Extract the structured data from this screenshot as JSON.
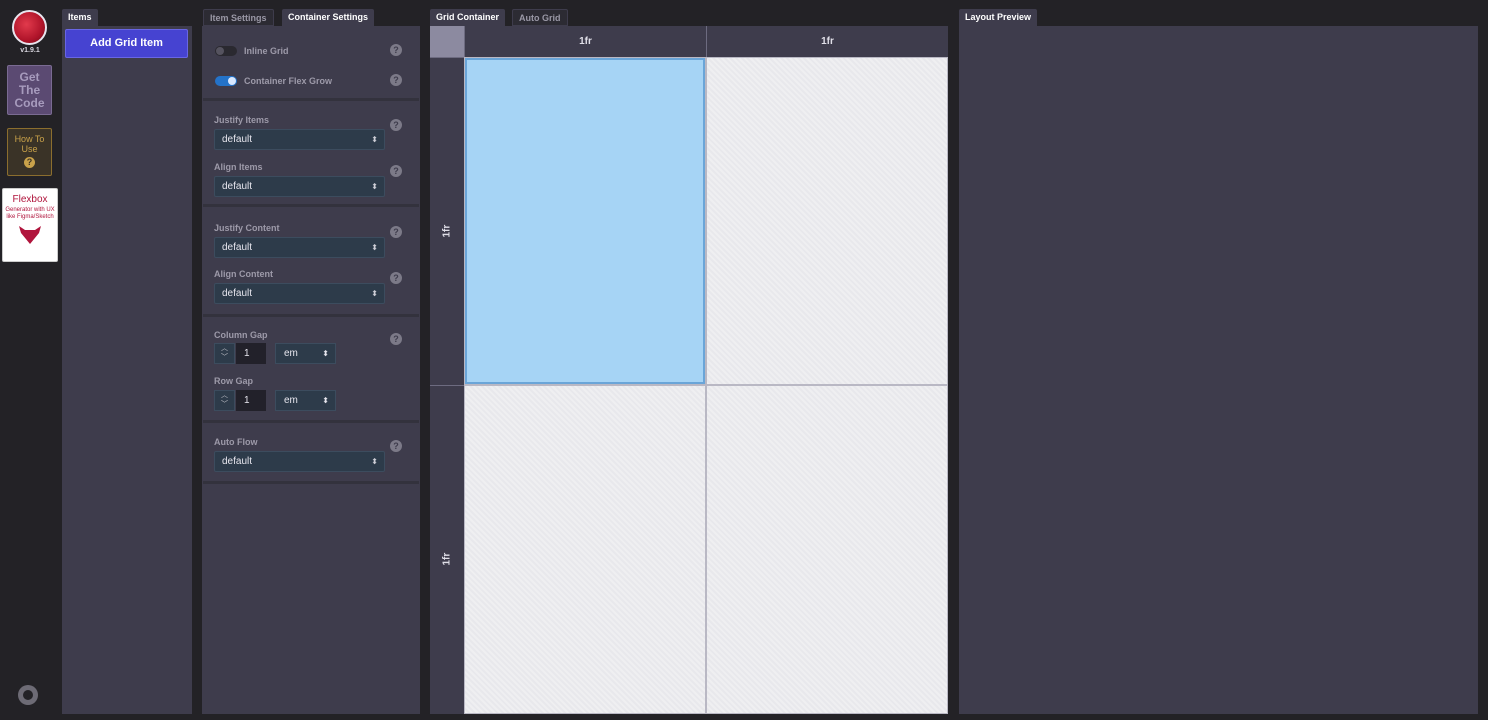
{
  "rail": {
    "version": "v1.9.1",
    "get_code": "Get The Code",
    "how_to_use": "How To Use",
    "how_to_use_icon": "?",
    "flexbox_title": "Flexbox",
    "flexbox_sub": "Generator with UX like Figma/Sketch"
  },
  "items": {
    "tab": "Items",
    "add_button": "Add Grid Item"
  },
  "settings": {
    "tabs": [
      "Item Settings",
      "Container Settings"
    ],
    "inline_grid": "Inline Grid",
    "container_flex_grow": "Container Flex Grow",
    "justify_items": {
      "label": "Justify Items",
      "value": "default"
    },
    "align_items": {
      "label": "Align Items",
      "value": "default"
    },
    "justify_content": {
      "label": "Justify Content",
      "value": "default"
    },
    "align_content": {
      "label": "Align Content",
      "value": "default"
    },
    "column_gap": {
      "label": "Column Gap",
      "value": "1",
      "unit": "em"
    },
    "row_gap": {
      "label": "Row Gap",
      "value": "1",
      "unit": "em"
    },
    "auto_flow": {
      "label": "Auto Flow",
      "value": "default"
    },
    "help": "?",
    "select_arrow": "⬍",
    "step_up": "︿",
    "step_down": "﹀"
  },
  "grid": {
    "tabs": [
      "Grid Container",
      "Auto Grid"
    ],
    "columns": [
      "1fr",
      "1fr"
    ],
    "rows": [
      "1fr",
      "1fr"
    ]
  },
  "preview": {
    "tab": "Layout Preview"
  },
  "colors": {
    "accent": "#4643d1",
    "toggle_on": "#2473c9",
    "selected_cell": "#a6d4f5"
  }
}
